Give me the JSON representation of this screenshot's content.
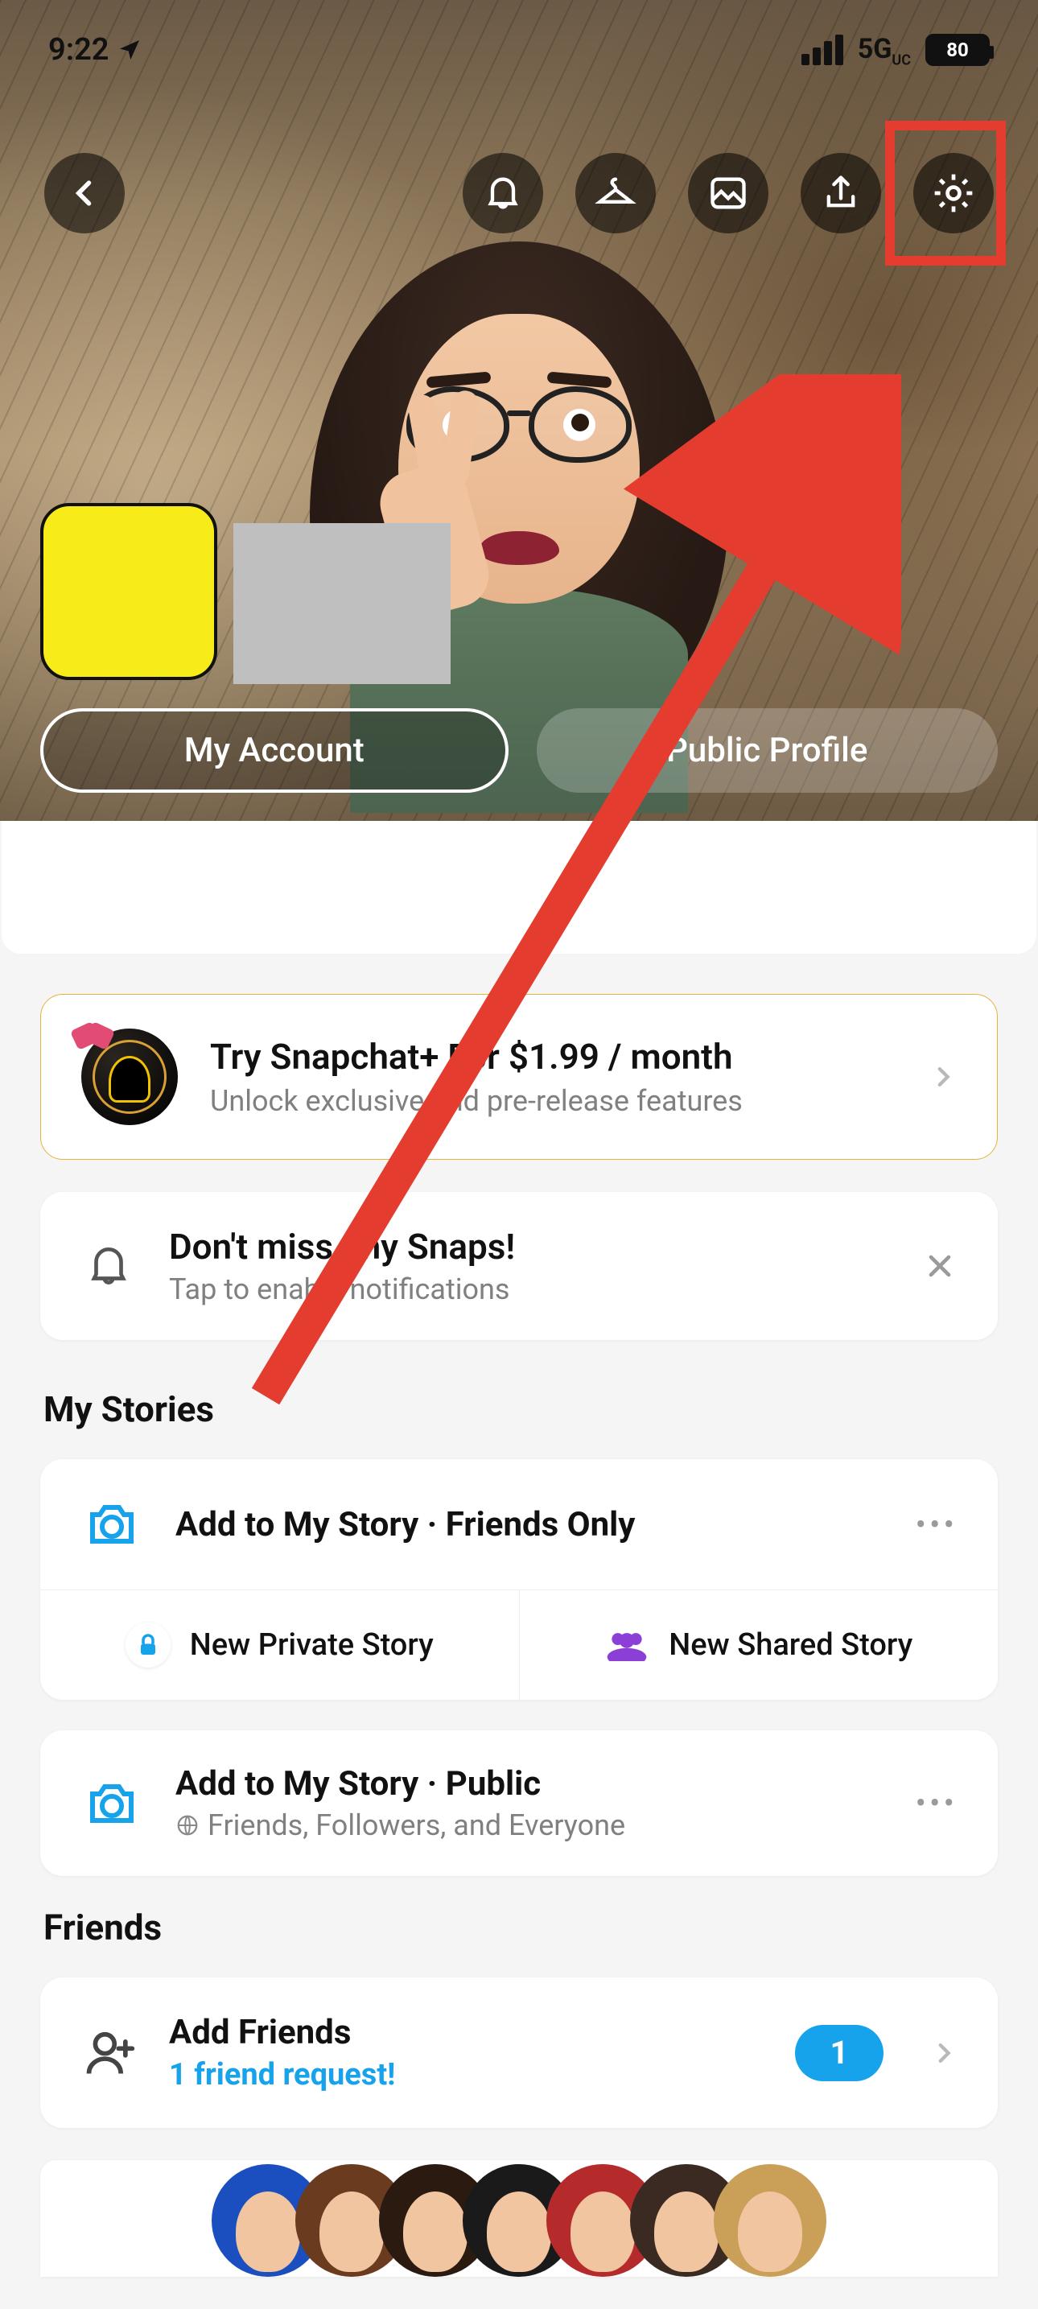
{
  "status": {
    "time": "9:22",
    "network": "5G",
    "network_sub": "UC",
    "battery": "80"
  },
  "tabs": {
    "my_account": "My Account",
    "public_profile": "Public Profile"
  },
  "promo": {
    "title": "Try Snapchat+ For $1.99 / month",
    "subtitle": "Unlock exclusive and pre-release features"
  },
  "notif": {
    "title": "Don't miss any Snaps!",
    "subtitle": "Tap to enable notifications"
  },
  "sections": {
    "stories": "My Stories",
    "friends": "Friends"
  },
  "stories": {
    "my_story_friends": "Add to My Story · Friends Only",
    "new_private": "New Private Story",
    "new_shared": "New Shared Story",
    "my_story_public_title": "Add to My Story · Public",
    "my_story_public_sub": "Friends, Followers, and Everyone"
  },
  "friends": {
    "add_title": "Add Friends",
    "request_sub": "1 friend request!",
    "badge": "1"
  }
}
